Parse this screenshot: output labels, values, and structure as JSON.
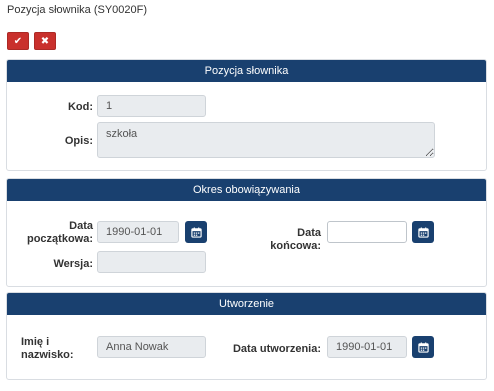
{
  "page": {
    "title": "Pozycja słownika (SY0020F)"
  },
  "toolbar": {
    "confirm_icon": "✔",
    "cancel_icon": "✖"
  },
  "sections": {
    "item": {
      "title": "Pozycja słownika",
      "kod_label": "Kod:",
      "kod_value": "1",
      "opis_label": "Opis:",
      "opis_value": "szkoła"
    },
    "validity": {
      "title": "Okres obowiązywania",
      "start_label_line1": "Data",
      "start_label_line2": "początkowa:",
      "start_value": "1990-01-01",
      "end_label": "Data końcowa:",
      "end_value": "",
      "version_label": "Wersja:",
      "version_value": ""
    },
    "creation": {
      "title": "Utworzenie",
      "name_label_line1": "Imię i",
      "name_label_line2": "nazwisko:",
      "name_value": "Anna Nowak",
      "date_label": "Data utworzenia:",
      "date_value": "1990-01-01"
    }
  },
  "icons": {
    "calendar": "calendar-icon",
    "confirm": "check-icon",
    "cancel": "close-icon"
  },
  "colors": {
    "header": "#19406f",
    "action": "#c9302c"
  }
}
